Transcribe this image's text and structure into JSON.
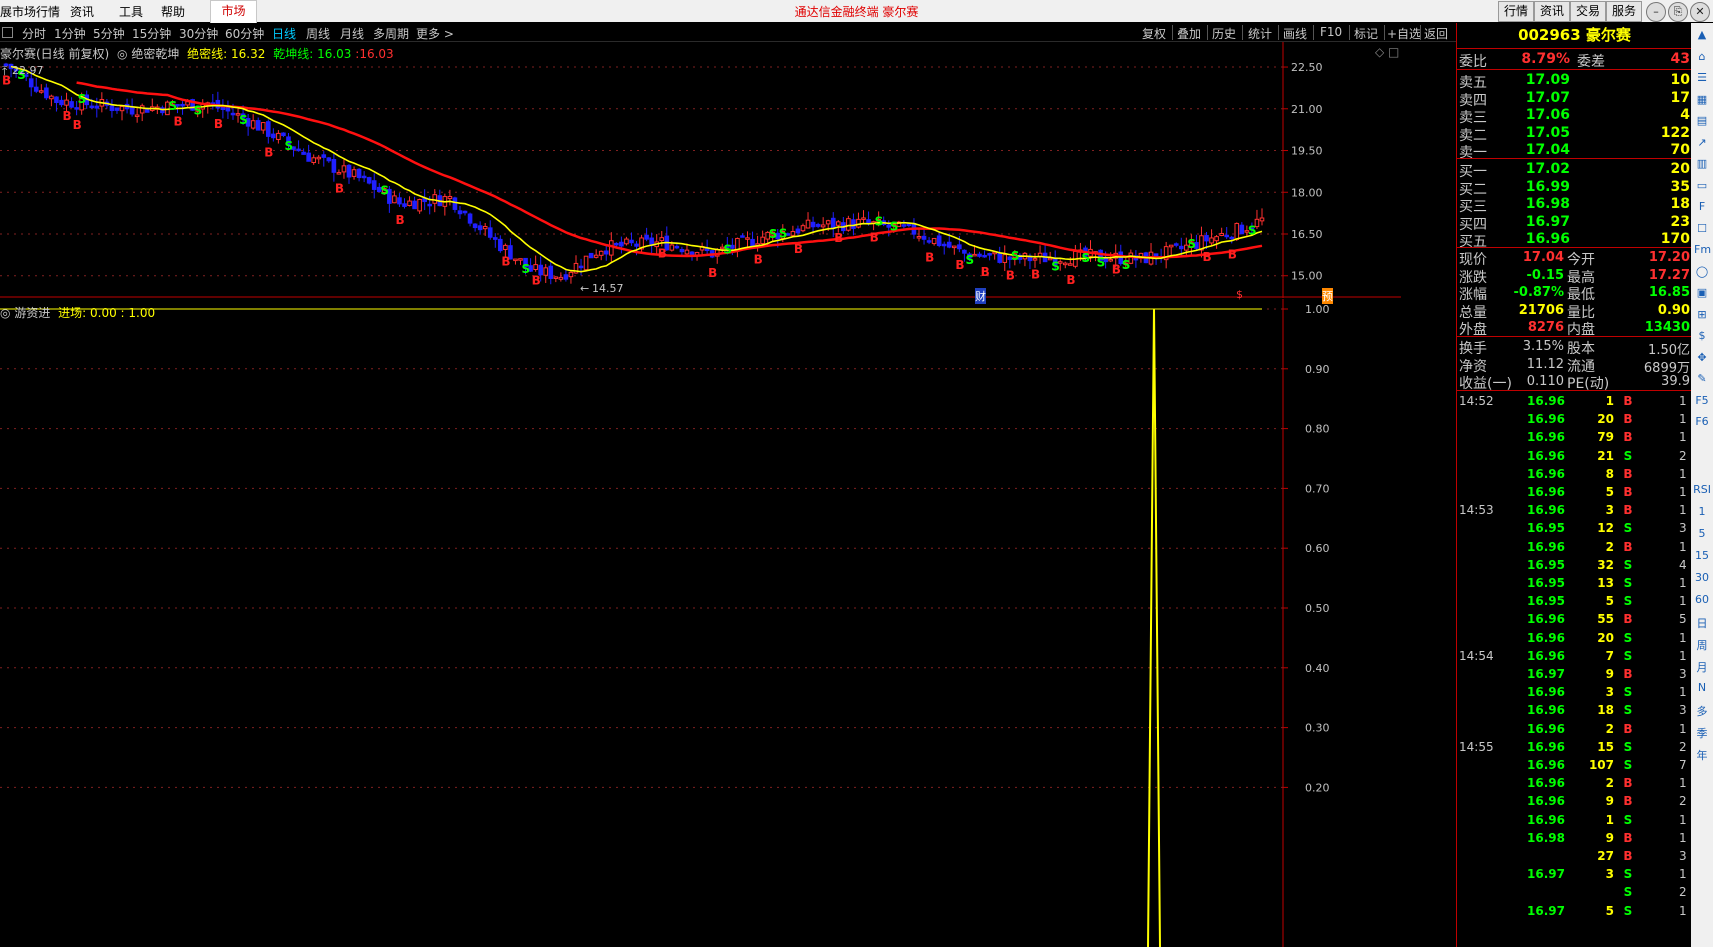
{
  "window": {
    "app_title": "通达信金融终端  豪尔赛",
    "menu": [
      "展市场行情",
      "资讯",
      "工具",
      "帮助"
    ],
    "market_tab": "市场",
    "top_buttons": [
      "行情",
      "资讯",
      "交易",
      "服务"
    ],
    "win_buttons": [
      "–",
      "⎘",
      "✕"
    ]
  },
  "period_bar": {
    "periods": [
      {
        "label": "分时",
        "active": false
      },
      {
        "label": "1分钟",
        "active": false
      },
      {
        "label": "5分钟",
        "active": false
      },
      {
        "label": "15分钟",
        "active": false
      },
      {
        "label": "30分钟",
        "active": false
      },
      {
        "label": "60分钟",
        "active": false
      },
      {
        "label": "日线",
        "active": true
      },
      {
        "label": "周线",
        "active": false
      },
      {
        "label": "月线",
        "active": false
      },
      {
        "label": "多周期",
        "active": false
      },
      {
        "label": "更多 >",
        "active": false
      }
    ],
    "tools": [
      "复权",
      "叠加",
      "历史",
      "统计",
      "画线",
      "F10",
      "标记",
      "+自选",
      "返回"
    ]
  },
  "main_chart": {
    "title": "豪尔赛(日线 前复权)",
    "indicator_name": "绝密乾坤",
    "line1_label": "绝密线: 16.32",
    "line2_label": "乾坤线: 16.03",
    "line2_extra": "16.03",
    "high_marker": "22.97",
    "low_marker": "14.57",
    "y_ticks": [
      "22.50",
      "21.00",
      "19.50",
      "18.00",
      "16.50",
      "15.00"
    ],
    "y_range": [
      14.2,
      23.4
    ],
    "event_markers": [
      "财",
      "$",
      "预"
    ],
    "colors": {
      "up": "#ff3030",
      "down": "#2020ff",
      "ma_slow": "#ff1010",
      "ma_fast": "#ffff00",
      "buy": "#ff2020",
      "sell": "#00ff00"
    }
  },
  "indicator": {
    "title": "游资进",
    "label": "进场: 0.00 : 1.00",
    "y_ticks": [
      "1.00",
      "0.90",
      "0.80",
      "0.70",
      "0.60",
      "0.50",
      "0.40",
      "0.30",
      "0.20"
    ],
    "y_range": [
      0,
      1.0
    ]
  },
  "quote": {
    "code": "002963",
    "name": "豪尔赛",
    "weibi_label": "委比",
    "weibi": "8.79%",
    "weicha_label": "委差",
    "weicha": "43",
    "asks": [
      {
        "label": "卖五",
        "price": "17.09",
        "vol": "10"
      },
      {
        "label": "卖四",
        "price": "17.07",
        "vol": "17"
      },
      {
        "label": "卖三",
        "price": "17.06",
        "vol": "4"
      },
      {
        "label": "卖二",
        "price": "17.05",
        "vol": "122"
      },
      {
        "label": "卖一",
        "price": "17.04",
        "vol": "70"
      }
    ],
    "bids": [
      {
        "label": "买一",
        "price": "17.02",
        "vol": "20"
      },
      {
        "label": "买二",
        "price": "16.99",
        "vol": "35"
      },
      {
        "label": "买三",
        "price": "16.98",
        "vol": "18"
      },
      {
        "label": "买四",
        "price": "16.97",
        "vol": "23"
      },
      {
        "label": "买五",
        "price": "16.96",
        "vol": "170"
      }
    ],
    "stats1": [
      {
        "l1": "现价",
        "v1": "17.04",
        "c1": "#ff3030",
        "l2": "今开",
        "v2": "17.20",
        "c2": "#ff3030"
      },
      {
        "l1": "涨跌",
        "v1": "-0.15",
        "c1": "#00ff00",
        "l2": "最高",
        "v2": "17.27",
        "c2": "#ff3030"
      },
      {
        "l1": "涨幅",
        "v1": "-0.87%",
        "c1": "#00ff00",
        "l2": "最低",
        "v2": "16.85",
        "c2": "#00ff00"
      },
      {
        "l1": "总量",
        "v1": "21706",
        "c1": "#ffff00",
        "l2": "量比",
        "v2": "0.90",
        "c2": "#ffff00"
      },
      {
        "l1": "外盘",
        "v1": "8276",
        "c1": "#ff3030",
        "l2": "内盘",
        "v2": "13430",
        "c2": "#00ff00"
      }
    ],
    "stats2": [
      {
        "l1": "换手",
        "v1": "3.15%",
        "l2": "股本",
        "v2": "1.50亿"
      },
      {
        "l1": "净资",
        "v1": "11.12",
        "l2": "流通",
        "v2": "6899万"
      },
      {
        "l1": "收益(一)",
        "v1": "0.110",
        "l2": "PE(动)",
        "v2": "39.9"
      }
    ]
  },
  "ticks": [
    {
      "time": "14:52",
      "price": "16.96",
      "vol": "1",
      "dir": "B",
      "n": "1"
    },
    {
      "time": "",
      "price": "16.96",
      "vol": "20",
      "dir": "B",
      "n": "1"
    },
    {
      "time": "",
      "price": "16.96",
      "vol": "79",
      "dir": "B",
      "n": "1"
    },
    {
      "time": "",
      "price": "16.96",
      "vol": "21",
      "dir": "S",
      "n": "2"
    },
    {
      "time": "",
      "price": "16.96",
      "vol": "8",
      "dir": "B",
      "n": "1"
    },
    {
      "time": "",
      "price": "16.96",
      "vol": "5",
      "dir": "B",
      "n": "1"
    },
    {
      "time": "14:53",
      "price": "16.96",
      "vol": "3",
      "dir": "B",
      "n": "1"
    },
    {
      "time": "",
      "price": "16.95",
      "vol": "12",
      "dir": "S",
      "n": "3"
    },
    {
      "time": "",
      "price": "16.96",
      "vol": "2",
      "dir": "B",
      "n": "1"
    },
    {
      "time": "",
      "price": "16.95",
      "vol": "32",
      "dir": "S",
      "n": "4"
    },
    {
      "time": "",
      "price": "16.95",
      "vol": "13",
      "dir": "S",
      "n": "1"
    },
    {
      "time": "",
      "price": "16.95",
      "vol": "5",
      "dir": "S",
      "n": "1"
    },
    {
      "time": "",
      "price": "16.96",
      "vol": "55",
      "dir": "B",
      "n": "5"
    },
    {
      "time": "",
      "price": "16.96",
      "vol": "20",
      "dir": "S",
      "n": "1"
    },
    {
      "time": "14:54",
      "price": "16.96",
      "vol": "7",
      "dir": "S",
      "n": "1"
    },
    {
      "time": "",
      "price": "16.97",
      "vol": "9",
      "dir": "B",
      "n": "3"
    },
    {
      "time": "",
      "price": "16.96",
      "vol": "3",
      "dir": "S",
      "n": "1"
    },
    {
      "time": "",
      "price": "16.96",
      "vol": "18",
      "dir": "S",
      "n": "3"
    },
    {
      "time": "",
      "price": "16.96",
      "vol": "2",
      "dir": "B",
      "n": "1"
    },
    {
      "time": "14:55",
      "price": "16.96",
      "vol": "15",
      "dir": "S",
      "n": "2"
    },
    {
      "time": "",
      "price": "16.96",
      "vol": "107",
      "dir": "S",
      "n": "7"
    },
    {
      "time": "",
      "price": "16.96",
      "vol": "2",
      "dir": "B",
      "n": "1"
    },
    {
      "time": "",
      "price": "16.96",
      "vol": "9",
      "dir": "B",
      "n": "2"
    },
    {
      "time": "",
      "price": "16.96",
      "vol": "1",
      "dir": "S",
      "n": "1"
    },
    {
      "time": "",
      "price": "16.98",
      "vol": "9",
      "dir": "B",
      "n": "1"
    },
    {
      "time": "",
      "price": "",
      "vol": "27",
      "dir": "B",
      "n": "3"
    },
    {
      "time": "",
      "price": "16.97",
      "vol": "3",
      "dir": "S",
      "n": "1"
    },
    {
      "time": "",
      "price": "",
      "vol": "",
      "dir": "S",
      "n": "2"
    },
    {
      "time": "",
      "price": "16.97",
      "vol": "5",
      "dir": "S",
      "n": "1"
    }
  ],
  "side_strip": {
    "icons": [
      "chevron-up-icon",
      "home-icon",
      "list-icon",
      "report-icon",
      "grid-icon",
      "chart-icon",
      "candle-icon",
      "doc-icon",
      "f10-icon",
      "news-icon",
      "fm-icon",
      "circle-icon",
      "bars-icon",
      "rsi-icon",
      "dollar-icon",
      "move-icon",
      "pencil-icon",
      "f5-icon",
      "f6-icon"
    ],
    "texts": [
      "RSI",
      "1",
      "5",
      "15",
      "30",
      "60",
      "日",
      "周",
      "月",
      "N",
      "多",
      "季",
      "年"
    ]
  }
}
